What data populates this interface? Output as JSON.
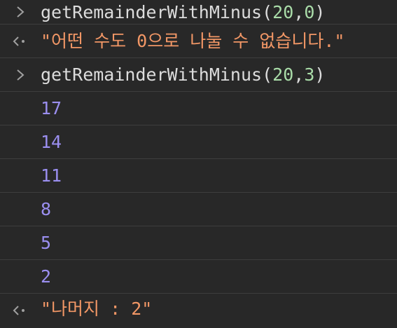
{
  "console": {
    "entries": [
      {
        "kind": "input",
        "icon": "chevron-right-icon",
        "func": "getRemainderWithMinus",
        "open": "(",
        "arg1": "20",
        "comma": ",",
        "arg2": "0",
        "close": ")"
      },
      {
        "kind": "result",
        "icon": "return-arrow-icon",
        "text": "\"어떤 수도 0으로 나눌 수 없습니다.\""
      },
      {
        "kind": "input",
        "icon": "chevron-right-icon",
        "func": "getRemainderWithMinus",
        "open": "(",
        "arg1": "20",
        "comma": ",",
        "arg2": "3",
        "close": ")"
      },
      {
        "kind": "log",
        "text": "17"
      },
      {
        "kind": "log",
        "text": "14"
      },
      {
        "kind": "log",
        "text": "11"
      },
      {
        "kind": "log",
        "text": "8"
      },
      {
        "kind": "log",
        "text": "5"
      },
      {
        "kind": "log",
        "text": "2"
      },
      {
        "kind": "result",
        "icon": "return-arrow-icon",
        "text": "\"나머지 : 2\""
      }
    ]
  },
  "colors": {
    "background": "#282828",
    "divider": "#3e3e3e",
    "number": "#9b8ff0",
    "string": "#f29766",
    "argument": "#a9dca8",
    "code": "#dcdcdc"
  }
}
